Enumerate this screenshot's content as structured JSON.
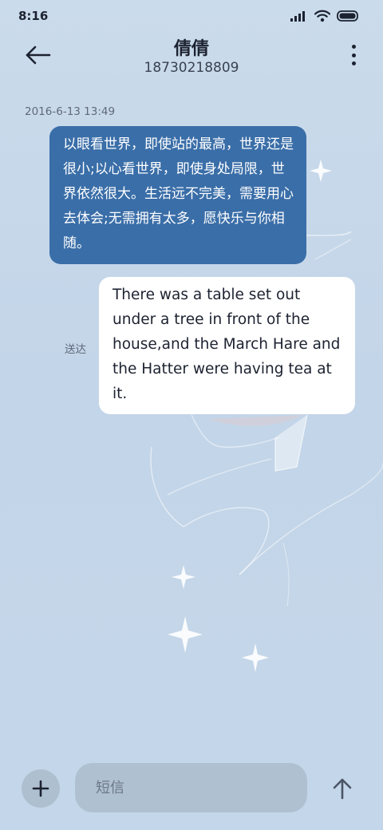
{
  "status_bar": {
    "time": "8:16"
  },
  "header": {
    "contact_name": "倩倩",
    "contact_number": "18730218809",
    "back_icon": "arrow-left-icon",
    "more_icon": "more-vertical-icon"
  },
  "conversation": {
    "timestamp": "2016-6-13 13:49",
    "incoming_message": "以眼看世界，即使站的最高，世界还是很小;以心看世界，即使身处局限，世界依然很大。生活远不完美，需要用心去体会;无需拥有太多，愿快乐与你相随。",
    "outgoing_message": "There was a table set out under a tree in front of the house,and the March Hare and the Hatter were having tea at it.",
    "sent_status": "送达"
  },
  "composer": {
    "placeholder": "短信",
    "add_icon": "plus-icon",
    "send_icon": "arrow-up-icon"
  },
  "colors": {
    "background": "#c8d9ea",
    "incoming_bubble": "#3a6ea8",
    "outgoing_bubble": "#ffffff",
    "input_background": "#afc0d1"
  }
}
